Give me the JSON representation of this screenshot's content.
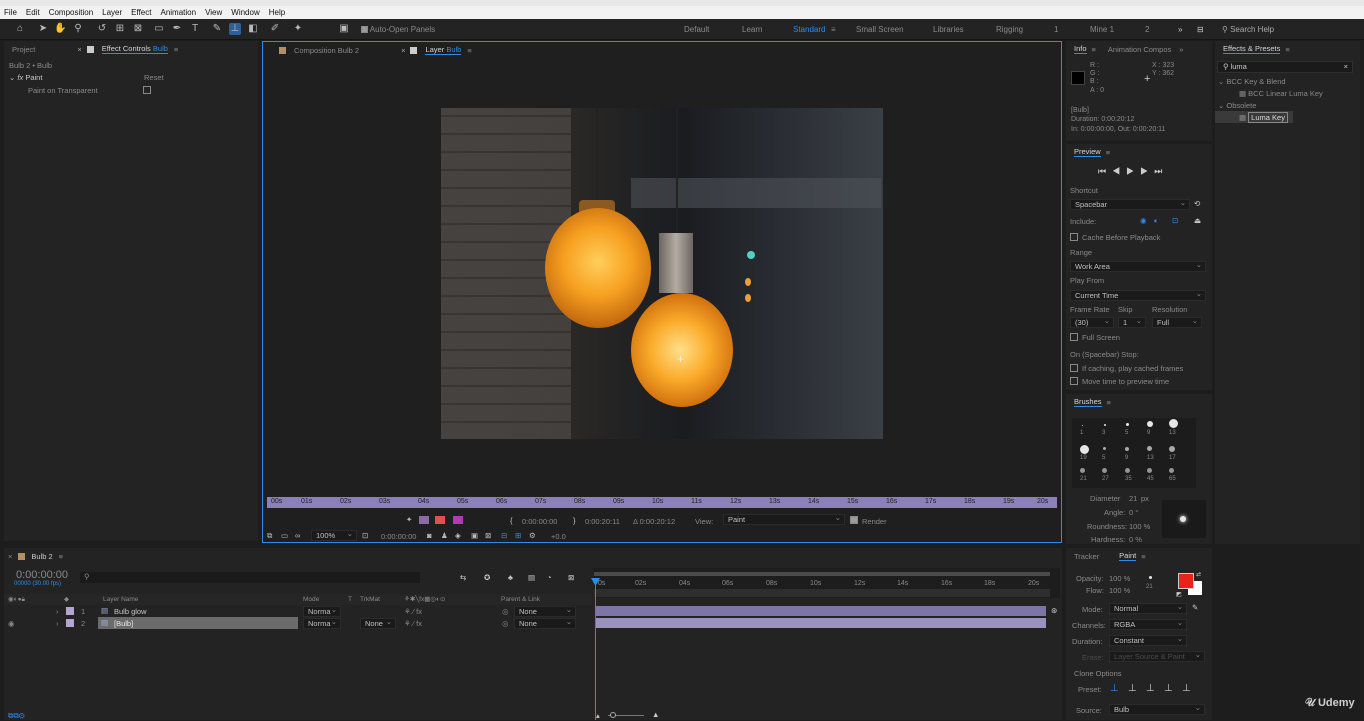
{
  "menu": [
    "File",
    "Edit",
    "Composition",
    "Layer",
    "Effect",
    "Animation",
    "View",
    "Window",
    "Help"
  ],
  "toolbar": {
    "auto_open_panels": "Auto-Open Panels"
  },
  "workspaces": [
    "Default",
    "Learn",
    "Standard",
    "Small Screen",
    "Libraries",
    "Rigging",
    "1",
    "Mine 1",
    "2"
  ],
  "search_help": "Search Help",
  "left_panel": {
    "tab_project": "Project",
    "tab_effect_controls": "Effect Controls",
    "tab_effect_target": "Bulb",
    "header": "Bulb 2 • Bulb",
    "fx_label": "fx",
    "effect_name": "Paint",
    "reset": "Reset",
    "param": "Paint on Transparent"
  },
  "viewer": {
    "tab_composition": "Composition",
    "tab_composition_name": "Bulb 2",
    "tab_layer": "Layer",
    "tab_layer_name": "Bulb",
    "ruler_ticks": [
      "00s",
      "01s",
      "02s",
      "03s",
      "04s",
      "05s",
      "06s",
      "07s",
      "08s",
      "09s",
      "10s",
      "11s",
      "12s",
      "13s",
      "14s",
      "15s",
      "16s",
      "17s",
      "18s",
      "19s",
      "20s"
    ],
    "time_in": "0:00:00:00",
    "time_out": "0:00:20:11",
    "time_duration": "Δ 0:00:20:12",
    "view_label": "View:",
    "view_value": "Paint",
    "render_label": "Render",
    "zoom": "100%",
    "timecode": "0:00:00:00",
    "exposure": "+0.0"
  },
  "info_panel": {
    "tab_info": "Info",
    "tab_animation": "Animation Compos",
    "r": "R :",
    "g": "G :",
    "b": "B :",
    "a": "A : 0",
    "x": "X : 323",
    "y": "Y : 362",
    "layer_name": "[Bulb]",
    "duration": "Duration: 0:00:20:12",
    "in_out": "In: 0:00:00:00, Out: 0:00:20:11"
  },
  "preview": {
    "title": "Preview",
    "shortcut_label": "Shortcut",
    "shortcut_value": "Spacebar",
    "include_label": "Include:",
    "cache_before": "Cache Before Playback",
    "range_label": "Range",
    "range_value": "Work Area",
    "play_from_label": "Play From",
    "play_from_value": "Current Time",
    "frame_rate_label": "Frame Rate",
    "skip_label": "Skip",
    "resolution_label": "Resolution",
    "frame_rate_value": "(30)",
    "skip_value": "1",
    "resolution_value": "Full",
    "full_screen": "Full Screen",
    "on_stop": "On (Spacebar) Stop:",
    "if_caching": "If caching, play cached frames",
    "move_time": "Move time to preview time"
  },
  "brushes": {
    "title": "Brushes",
    "sizes": [
      "1",
      "3",
      "5",
      "9",
      "13",
      "19",
      "5",
      "9",
      "13",
      "17",
      "21",
      "27",
      "35",
      "45",
      "65"
    ],
    "diameter_label": "Diameter",
    "diameter_value": "21",
    "diameter_unit": "px",
    "angle_label": "Angle:",
    "angle_value": "0 °",
    "roundness_label": "Roundness:",
    "roundness_value": "100 %",
    "hardness_label": "Hardness:",
    "hardness_value": "0 %"
  },
  "effects_presets": {
    "title": "Effects & Presets",
    "search_value": "luma",
    "group1": "BCC Key & Blend",
    "item1": "BCC Linear Luma Key",
    "group2": "Obsolete",
    "item2": "Luma Key"
  },
  "paint_panel": {
    "tab_tracker": "Tracker",
    "tab_paint": "Paint",
    "opacity_label": "Opacity:",
    "opacity_value": "100 %",
    "flow_label": "Flow:",
    "flow_value": "100 %",
    "brush_size": "21",
    "mode_label": "Mode:",
    "mode_value": "Normal",
    "channels_label": "Channels:",
    "channels_value": "RGBA",
    "duration_label": "Duration:",
    "duration_value": "Constant",
    "erase_label": "Erase:",
    "erase_value": "Layer Source & Paint",
    "clone_options": "Clone Options",
    "preset_label": "Preset:",
    "source_label": "Source:",
    "source_value": "Bulb",
    "foreground_color": "#e8231a",
    "background_color": "#ffffff"
  },
  "timeline": {
    "comp_name": "Bulb 2",
    "timecode": "0:00:00:00",
    "fps": "00000 (30.00 fps)",
    "col_layer_name": "Layer Name",
    "col_mode": "Mode",
    "col_t": "T",
    "col_trkmat": "TrkMat",
    "col_parent": "Parent & Link",
    "layers": [
      {
        "num": "1",
        "name": "Bulb glow",
        "mode": "Norma",
        "trkmat": "",
        "parent": "None"
      },
      {
        "num": "2",
        "name": "[Bulb]",
        "mode": "Norma",
        "trkmat": "None",
        "parent": "None"
      }
    ],
    "ruler": [
      "0s",
      "02s",
      "04s",
      "06s",
      "08s",
      "10s",
      "12s",
      "14s",
      "16s",
      "18s",
      "20s"
    ]
  },
  "watermark": "Udemy"
}
